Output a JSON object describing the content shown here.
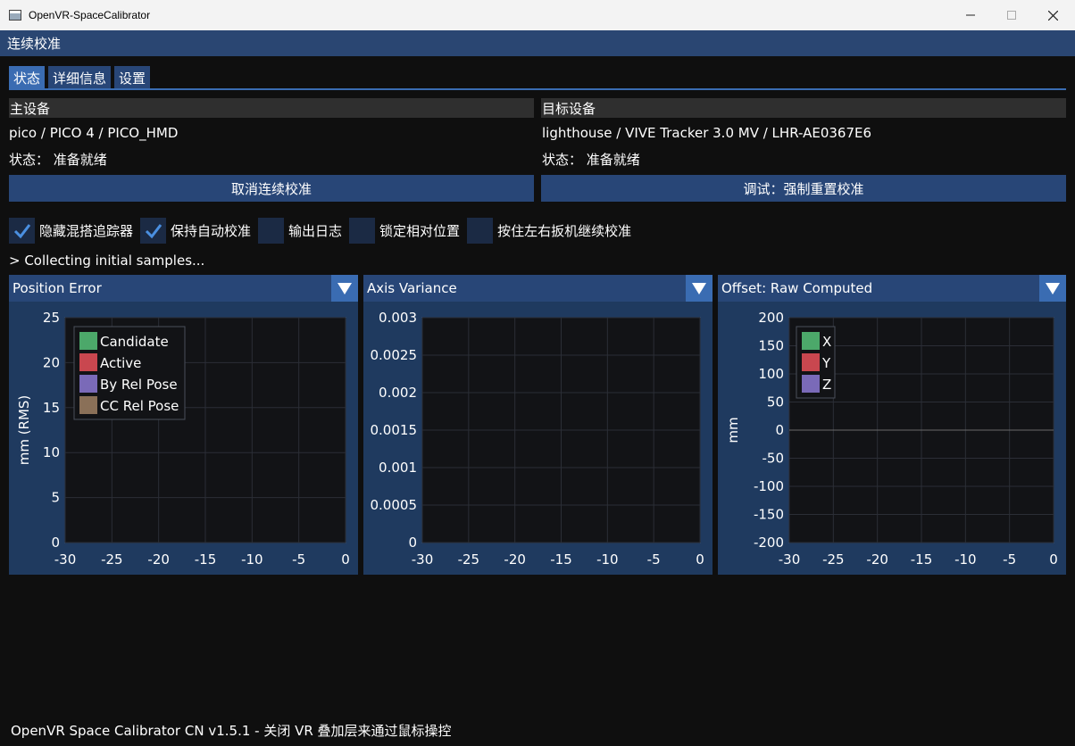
{
  "window": {
    "title": "OpenVR-SpaceCalibrator",
    "imgui_title": "连续校准"
  },
  "tabs": [
    {
      "label": "状态",
      "active": true
    },
    {
      "label": "详细信息",
      "active": false
    },
    {
      "label": "设置",
      "active": false
    }
  ],
  "reference": {
    "header": "主设备",
    "device": "pico / PICO 4 / PICO_HMD",
    "status": "状态：  准备就绪"
  },
  "target": {
    "header": "目标设备",
    "device": "lighthouse / VIVE Tracker 3.0 MV / LHR-AE0367E6",
    "status": "状态：  准备就绪"
  },
  "buttons": {
    "cancel": "取消连续校准",
    "force_reset": "调试：强制重置校准"
  },
  "checkboxes": [
    {
      "label": "隐藏混搭追踪器",
      "checked": true
    },
    {
      "label": "保持自动校准",
      "checked": true
    },
    {
      "label": "输出日志",
      "checked": false
    },
    {
      "label": "锁定相对位置",
      "checked": false
    },
    {
      "label": "按住左右扳机继续校准",
      "checked": false
    }
  ],
  "log_text": "> Collecting initial samples...",
  "colors": {
    "accent": "#3a6cb2",
    "frame": "#284677",
    "panel": "#1f3a5f",
    "green": "#4ca86a",
    "red": "#c9474f",
    "purple": "#7a6ab8",
    "brown": "#8a7058"
  },
  "chart_data": [
    {
      "type": "line",
      "selector": "Position Error",
      "ylabel": "mm (RMS)",
      "xlim": [
        -30,
        0
      ],
      "ylim": [
        0,
        25
      ],
      "x_ticks": [
        "-30",
        "-25",
        "-20",
        "-15",
        "-10",
        "-5",
        "0"
      ],
      "y_ticks": [
        "0",
        "5",
        "10",
        "15",
        "20",
        "25"
      ],
      "legend": "top-left",
      "series": [
        {
          "name": "Candidate",
          "values": []
        },
        {
          "name": "Active",
          "values": []
        },
        {
          "name": "By Rel Pose",
          "values": []
        },
        {
          "name": "CC Rel Pose",
          "values": []
        }
      ]
    },
    {
      "type": "line",
      "selector": "Axis Variance",
      "ylabel": "",
      "xlim": [
        -30,
        0
      ],
      "ylim": [
        0,
        0.003
      ],
      "x_ticks": [
        "-30",
        "-25",
        "-20",
        "-15",
        "-10",
        "-5",
        "0"
      ],
      "y_ticks": [
        "0",
        "0.0005",
        "0.001",
        "0.0015",
        "0.002",
        "0.0025",
        "0.003"
      ],
      "legend": "",
      "series": []
    },
    {
      "type": "line",
      "selector": "Offset: Raw Computed",
      "ylabel": "mm",
      "xlim": [
        -30,
        0
      ],
      "ylim": [
        -200,
        200
      ],
      "x_ticks": [
        "-30",
        "-25",
        "-20",
        "-15",
        "-10",
        "-5",
        "0"
      ],
      "y_ticks": [
        "-200",
        "-150",
        "-100",
        "-50",
        "0",
        "50",
        "100",
        "150",
        "200"
      ],
      "legend": "top-left",
      "series": [
        {
          "name": "X",
          "values": []
        },
        {
          "name": "Y",
          "values": []
        },
        {
          "name": "Z",
          "values": []
        }
      ]
    }
  ],
  "footer": "OpenVR Space Calibrator CN v1.5.1  - 关闭 VR 叠加层来通过鼠标操控"
}
